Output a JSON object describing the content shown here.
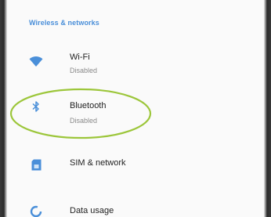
{
  "section": {
    "title": "Wireless & networks"
  },
  "items": [
    {
      "icon": "wifi-icon",
      "title": "Wi-Fi",
      "subtitle": "Disabled"
    },
    {
      "icon": "bluetooth-icon",
      "title": "Bluetooth",
      "subtitle": "Disabled"
    },
    {
      "icon": "sim-card-icon",
      "title": "SIM & network"
    },
    {
      "icon": "data-usage-icon",
      "title": "Data usage"
    }
  ],
  "colors": {
    "accent": "#4a8fd9",
    "highlight": "#9cc63a",
    "title_text": "#222222",
    "subtitle_text": "#8a8a8a"
  }
}
